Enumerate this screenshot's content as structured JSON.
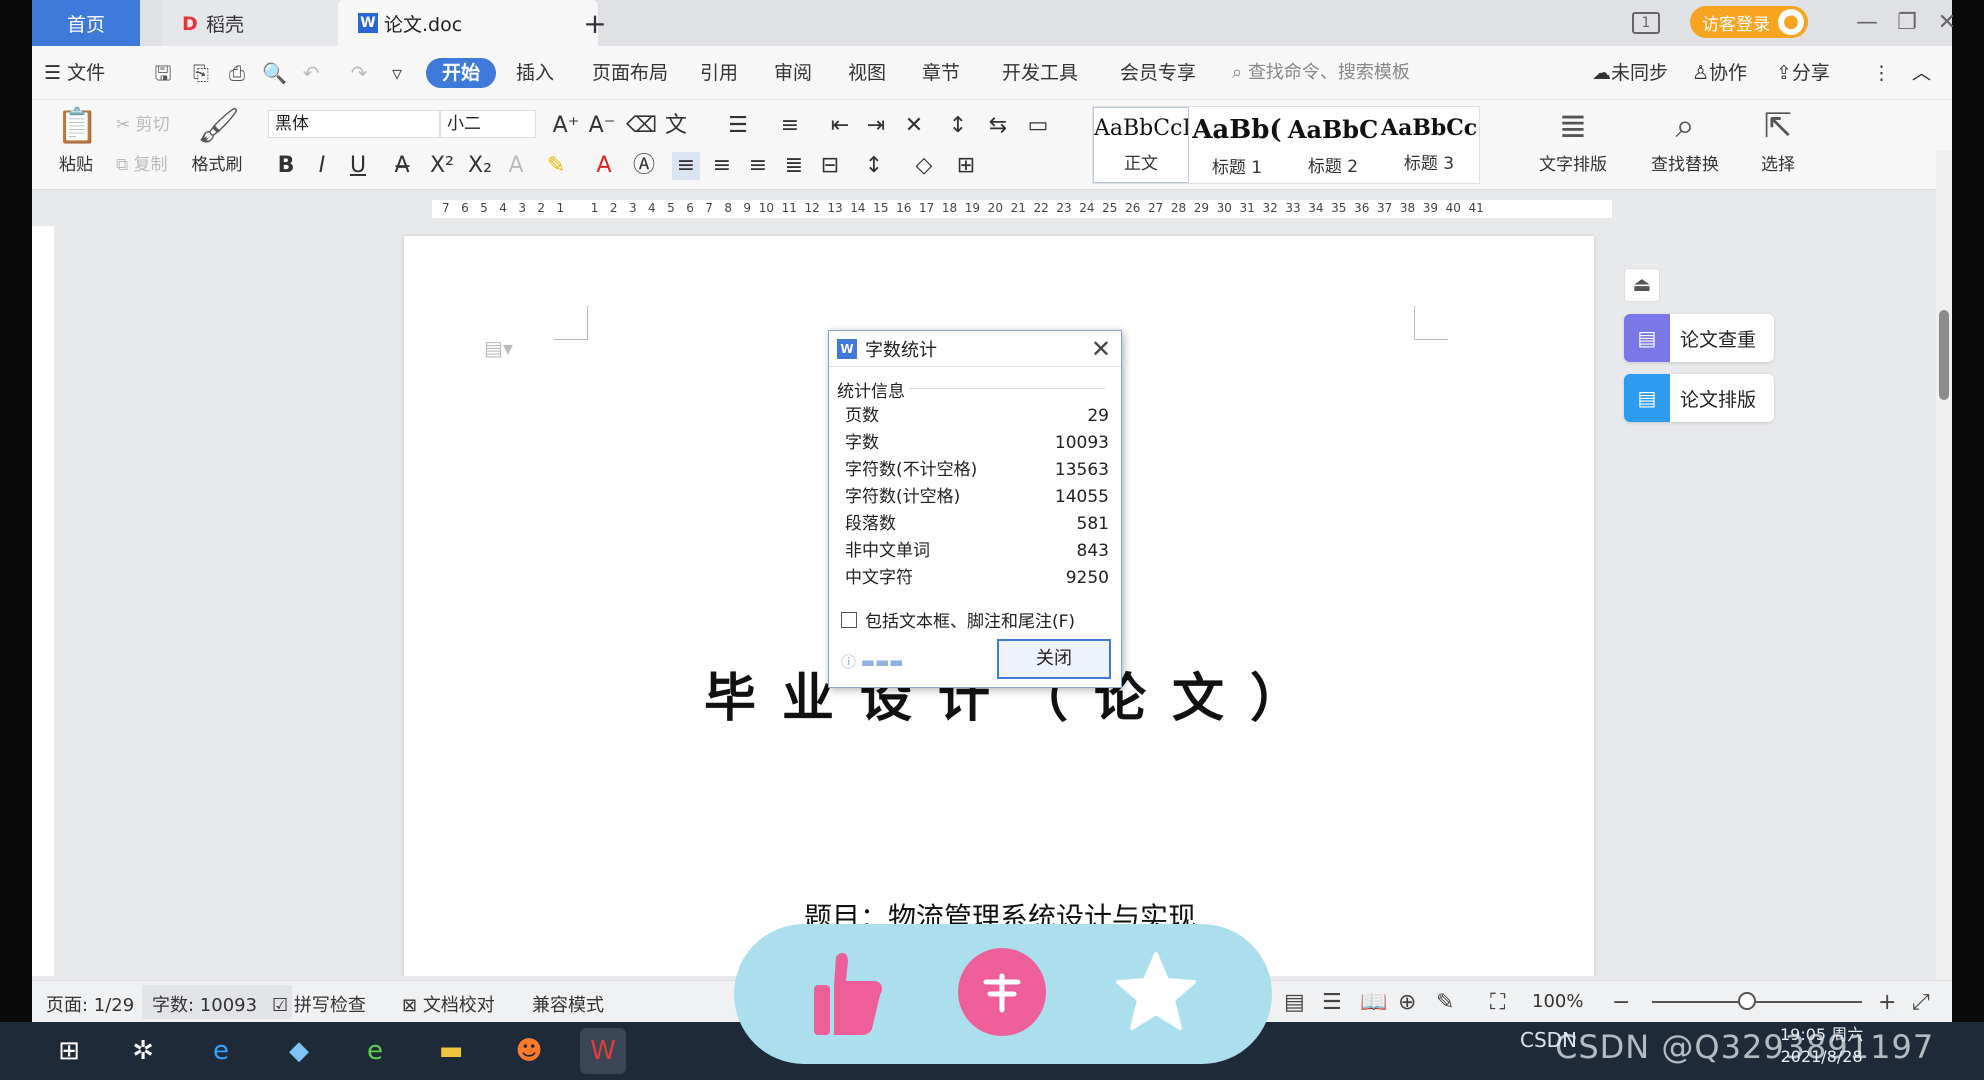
{
  "tabs": {
    "home": "首页",
    "daoke": "稻壳",
    "doc": "论文.doc",
    "add": "+"
  },
  "visitor_login": "访客登录",
  "menu": {
    "file": "文件",
    "start": "开始",
    "insert": "插入",
    "layout": "页面布局",
    "reference": "引用",
    "review": "审阅",
    "view": "视图",
    "chapter": "章节",
    "devtools": "开发工具",
    "member": "会员专享",
    "search_placeholder": "查找命令、搜索模板",
    "unsync": "未同步",
    "collab": "协作",
    "share": "分享"
  },
  "ribbon": {
    "paste": "粘贴",
    "cut": "剪切",
    "copy": "复制",
    "format_painter": "格式刷",
    "font_name": "黑体",
    "font_size": "小二",
    "text_layout": "文字排版",
    "find_replace": "查找替换",
    "select": "选择",
    "styles": [
      {
        "sample": "AaBbCcI",
        "name": "正文"
      },
      {
        "sample": "AaBb(",
        "name": "标题 1"
      },
      {
        "sample": "AaBbC",
        "name": "标题 2"
      },
      {
        "sample": "AaBbCcl",
        "name": "标题 3"
      }
    ]
  },
  "ruler": "7   6   5   4   3   2   1       1   2   3   4   5   6   7   8   9  10  11  12  13  14  15  16  17  18  19  20  21  22  23  24  25  26  27  28  29  30  31  32  33  34  35  36  37  38  39  40  41",
  "side_panel": {
    "paper_check": "论文查重",
    "paper_layout": "论文排版"
  },
  "document": {
    "title": "毕业设计（论文）",
    "subject_label": "题目：",
    "subject_value": "物流管理系统设计与实现"
  },
  "dialog": {
    "title": "字数统计",
    "section": "统计信息",
    "rows": [
      {
        "label": "页数",
        "value": "29"
      },
      {
        "label": "字数",
        "value": "10093"
      },
      {
        "label": "字符数(不计空格)",
        "value": "13563"
      },
      {
        "label": "字符数(计空格)",
        "value": "14055"
      },
      {
        "label": "段落数",
        "value": "581"
      },
      {
        "label": "非中文单词",
        "value": "843"
      },
      {
        "label": "中文字符",
        "value": "9250"
      }
    ],
    "include_label": "包括文本框、脚注和尾注(F)",
    "include_checked": false,
    "close_button": "关闭"
  },
  "statusbar": {
    "page": "页面: 1/29",
    "words": "字数: 10093",
    "spell": "拼写检查",
    "proof": "文档校对",
    "compat": "兼容模式",
    "zoom": "100%"
  },
  "taskbar": {
    "tray_text": "CSDN",
    "time": "19:05 周六",
    "date": "2021/8/28"
  },
  "watermark": "CSDN @Q3293891197",
  "colors": {
    "accent": "#3f79d9",
    "visitor": "#f7a521",
    "pill": "#abdfee",
    "like": "#ee5f9a"
  }
}
